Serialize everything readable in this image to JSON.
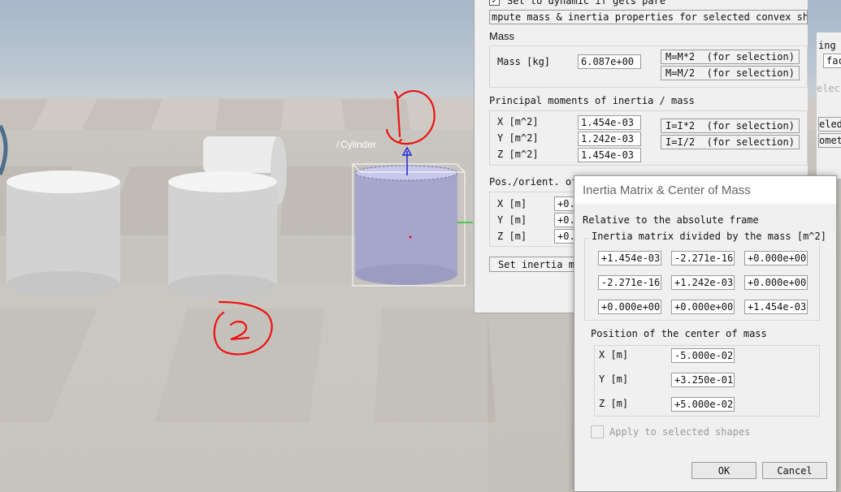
{
  "viewport": {
    "selected_object_label": "Cylinder",
    "annotations": [
      "1",
      "2"
    ]
  },
  "dynamics_panel": {
    "dynamic_checkbox_label": "Set to dynamic if gets pare",
    "compute_button_label": "mpute mass & inertia properties for selected convex shap",
    "mass_section": "Mass",
    "mass_label": "Mass [kg]",
    "mass_value": "6.087e+00",
    "mass_double_button": "M=M*2  (for selection)",
    "mass_half_button": "M=M/2  (for selection)",
    "inertia_section": "Principal moments of inertia / mass",
    "inertia_rows": [
      {
        "label": "X [m^2]",
        "value": "1.454e-03"
      },
      {
        "label": "Y [m^2]",
        "value": "1.242e-03"
      },
      {
        "label": "Z [m^2]",
        "value": "1.454e-03"
      }
    ],
    "inertia_double_button": "I=I*2  (for selection)",
    "inertia_half_button": "I=I/2  (for selection)",
    "posorient_section": "Pos./orient. of",
    "pos_rows": [
      {
        "label": "X [m]",
        "value": "+0."
      },
      {
        "label": "Y [m]",
        "value": "+0."
      },
      {
        "label": "Z [m]",
        "value": "+0."
      }
    ],
    "set_inertia_button": "Set inertia ma"
  },
  "side_strip": {
    "items": [
      "ing",
      "fac",
      "elec",
      "eled",
      "omet"
    ]
  },
  "inertia_dialog": {
    "title": "Inertia Matrix & Center of Mass",
    "relative_to": "Relative to the absolute frame",
    "matrix_caption": "Inertia matrix divided by the mass [m^2]",
    "matrix": [
      [
        "+1.454e-03",
        "-2.271e-16",
        "+0.000e+00"
      ],
      [
        "-2.271e-16",
        "+1.242e-03",
        "+0.000e+00"
      ],
      [
        "+0.000e+00",
        "+0.000e+00",
        "+1.454e-03"
      ]
    ],
    "com_caption": "Position of the center of mass",
    "com_rows": [
      {
        "label": "X [m]",
        "value": "-5.000e-02"
      },
      {
        "label": "Y [m]",
        "value": "+3.250e-01"
      },
      {
        "label": "Z [m]",
        "value": "+5.000e-02"
      }
    ],
    "apply_label": "Apply to selected shapes",
    "ok_label": "OK",
    "cancel_label": "Cancel"
  },
  "colors": {
    "selected_cylinder": "#a6a6cc",
    "annotation_red": "#ee1111",
    "axis_blue": "#2222dd"
  }
}
